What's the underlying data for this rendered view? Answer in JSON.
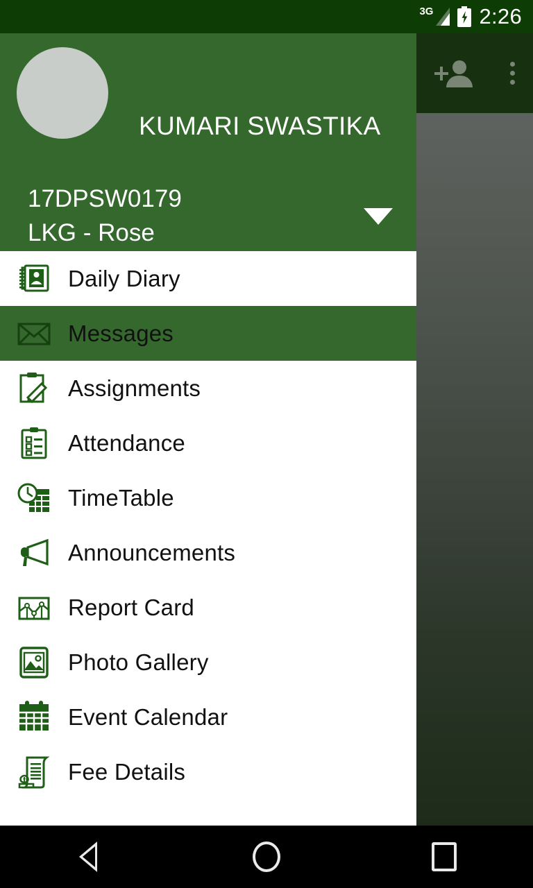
{
  "status_bar": {
    "network_label": "3G",
    "network_icon": "signal-3g-icon",
    "battery_icon": "battery-charging-icon",
    "time": "2:26"
  },
  "toolbar": {
    "add_person_icon": "add-person-icon",
    "overflow_icon": "overflow-menu-icon"
  },
  "drawer": {
    "avatar_icon": "avatar-placeholder",
    "student_name": "KUMARI SWASTIKA",
    "student_id": "17DPSW0179",
    "student_class": "LKG - Rose",
    "caret_icon": "chevron-down-icon",
    "selected_item": "Messages",
    "items": [
      {
        "label": "Daily Diary",
        "icon": "daily-diary-icon",
        "selected": false
      },
      {
        "label": "Messages",
        "icon": "envelope-icon",
        "selected": true
      },
      {
        "label": "Assignments",
        "icon": "clipboard-pencil-icon",
        "selected": false
      },
      {
        "label": "Attendance",
        "icon": "clipboard-check-icon",
        "selected": false
      },
      {
        "label": "TimeTable",
        "icon": "clock-grid-icon",
        "selected": false
      },
      {
        "label": "Announcements",
        "icon": "megaphone-icon",
        "selected": false
      },
      {
        "label": "Report Card",
        "icon": "chart-card-icon",
        "selected": false
      },
      {
        "label": "Photo Gallery",
        "icon": "photo-image-icon",
        "selected": false
      },
      {
        "label": "Event Calendar",
        "icon": "calendar-icon",
        "selected": false
      },
      {
        "label": "Fee Details",
        "icon": "invoice-money-icon",
        "selected": false
      }
    ]
  },
  "navigation_bar": {
    "back_icon": "back-triangle-icon",
    "home_icon": "home-circle-icon",
    "recents_icon": "recents-square-icon"
  },
  "colors": {
    "status_bar": "#0d3d05",
    "drawer_header": "#34682d",
    "selected_row": "#34682d",
    "icon_green": "#1f5e17",
    "drawer_bg": "#ffffff",
    "nav_bar": "#000000"
  }
}
